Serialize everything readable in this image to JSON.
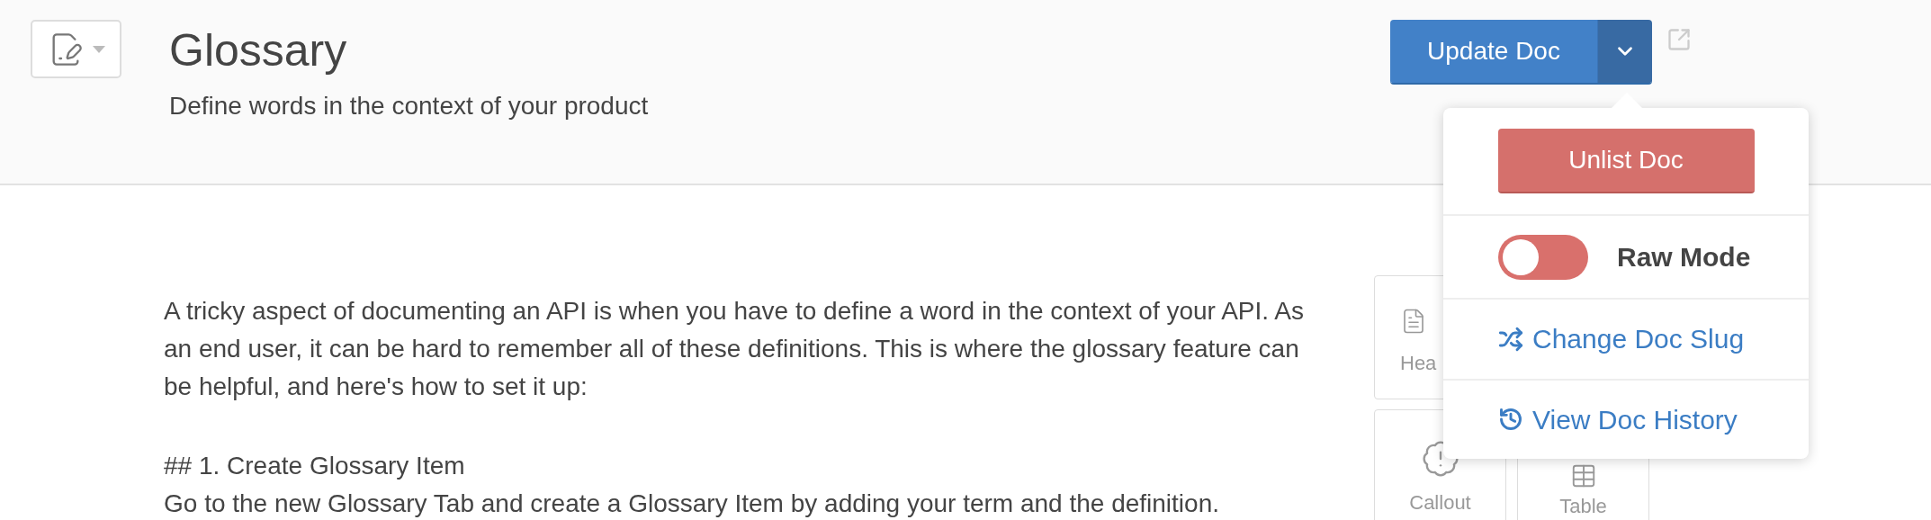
{
  "header": {
    "title": "Glossary",
    "subtitle": "Define words in the context of your product"
  },
  "actions": {
    "primary": "Update Doc",
    "menu_open": true
  },
  "menu": {
    "unlist": "Unlist Doc",
    "raw_mode": {
      "label": "Raw Mode",
      "on": false
    },
    "links": [
      {
        "kind": "slug",
        "label": "Change Doc Slug"
      },
      {
        "kind": "history",
        "label": "View Doc History"
      }
    ]
  },
  "editor": {
    "paragraphs": [
      {
        "lines": [
          "A tricky aspect of documenting an API is when you have to define a word in the context of your API. As an end user, it can be hard to remember all of these definitions. This is where the glossary feature can be helpful, and here's how to set it up:"
        ]
      },
      {
        "lines": [
          "## 1. Create Glossary Item",
          "Go to the new Glossary Tab and create a Glossary Item by adding your term and the definition."
        ]
      }
    ]
  },
  "blocks": [
    {
      "kind": "heading",
      "label": "Hea"
    },
    {
      "kind": "hidden"
    },
    {
      "kind": "callout",
      "label": "Callout"
    },
    {
      "kind": "table",
      "label": "Table"
    }
  ]
}
